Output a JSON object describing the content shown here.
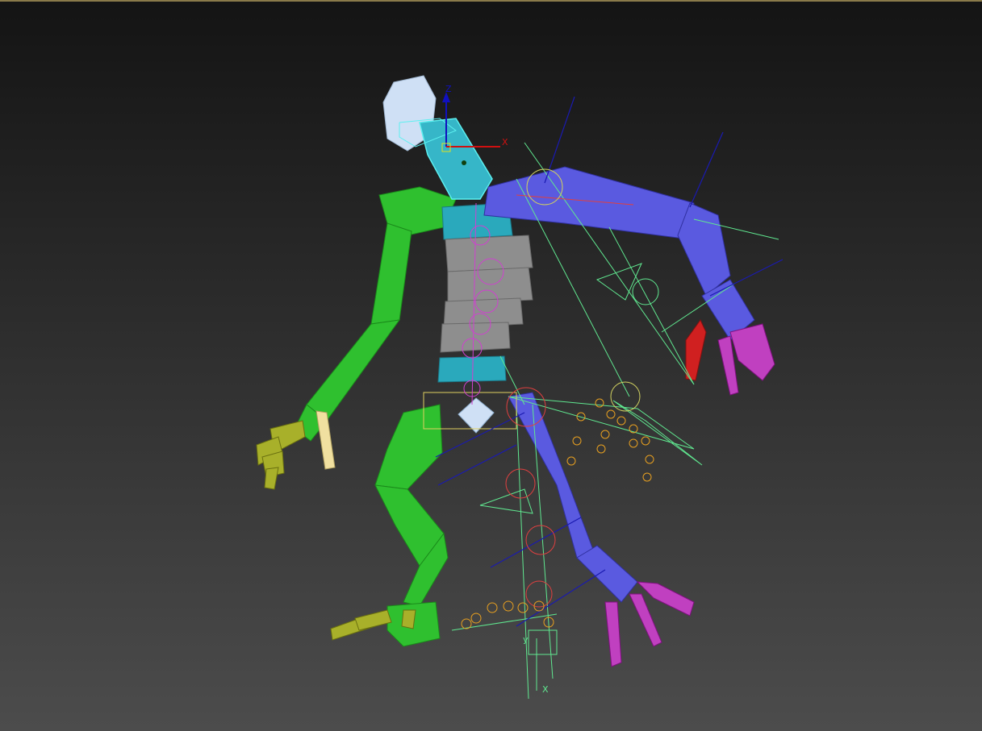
{
  "viewport": {
    "bg_top": "#141414",
    "bg_bottom": "#4c4c4c",
    "border_color": "#8a7a4a"
  },
  "gizmo": {
    "z_label": "Z",
    "x_label": "X",
    "y_label": "y",
    "x_color": "#d01010",
    "z_color": "#1010c0"
  },
  "colors": {
    "head": "#cfe0f5",
    "neck": "#36b6c8",
    "spine_box": "#8e8e8e",
    "pelvis": "#2aa9bc",
    "left_side": "#2fc02f",
    "right_side": "#5a5ae0",
    "fingers": "#a8b02a",
    "toes": "#c040c0",
    "selection": "#5cf0f0",
    "ik_helper": "#60e890",
    "bone_helper": "#d040d0",
    "orange_helper": "#e8a020",
    "red_helper": "#e04040"
  },
  "icons": {
    "transform_gizmo": "transform-gizmo-icon",
    "pivot_point": "pivot-point-icon"
  }
}
